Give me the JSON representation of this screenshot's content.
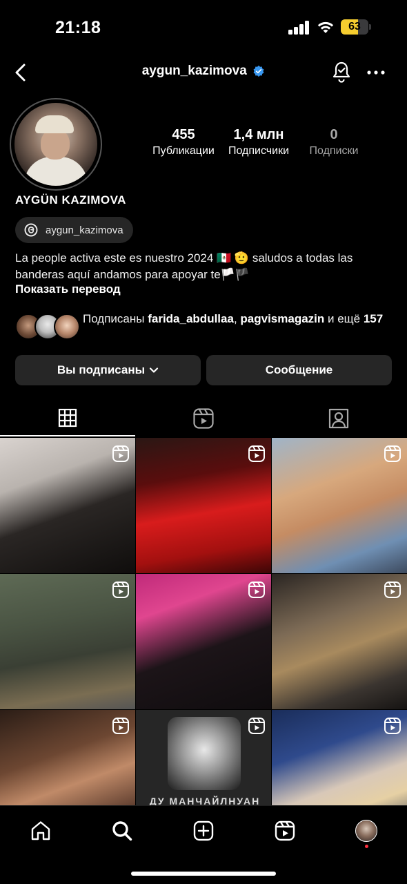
{
  "status_bar": {
    "time": "21:18",
    "battery_percent": "63",
    "battery_level": 0.63,
    "accent_color": "#f5cd2f"
  },
  "header": {
    "username": "aygun_kazimova",
    "verified": true,
    "icons": [
      "back-arrow-icon",
      "verified-badge-icon",
      "notification-bell-icon",
      "more-options-icon"
    ]
  },
  "profile": {
    "display_name": "AYGÜN KAZIMOVA",
    "stats": [
      {
        "value": "455",
        "label": "Публикации"
      },
      {
        "value": "1,4 млн",
        "label": "Подписчики"
      },
      {
        "value": "0",
        "label": "Подписки"
      }
    ],
    "threads_handle": "aygun_kazimova",
    "bio_line1": "La people activa este es nuestro 2024 🇲🇽 🫡 saludos a todas las",
    "bio_line2": "banderas aquí andamos para apoyar te🏳️🏴",
    "translate_label": "Показать перевод",
    "followed_by": {
      "prefix": "Подписаны ",
      "user1": "farida_abdullaa",
      "separator": ", ",
      "user2": "pagvismagazin",
      "and_more_prefix": " и ещё ",
      "more_count": "157"
    }
  },
  "actions": {
    "following_label": "Вы подписаны",
    "message_label": "Сообщение"
  },
  "tabs": [
    {
      "name": "grid",
      "icon": "grid-icon",
      "active": true
    },
    {
      "name": "reels",
      "icon": "reels-icon",
      "active": false
    },
    {
      "name": "tagged",
      "icon": "tagged-person-icon",
      "active": false
    }
  ],
  "grid": {
    "posts": [
      {
        "type": "reel"
      },
      {
        "type": "reel"
      },
      {
        "type": "reel"
      },
      {
        "type": "reel"
      },
      {
        "type": "reel"
      },
      {
        "type": "reel"
      },
      {
        "type": "reel"
      },
      {
        "type": "reel",
        "caption": "ДУ МАНЧАЙЛНУАН"
      },
      {
        "type": "reel"
      }
    ]
  },
  "bottom_nav": {
    "items": [
      "home-icon",
      "search-icon",
      "create-icon",
      "reels-icon",
      "profile-avatar"
    ],
    "active": "search",
    "notification_dot_color": "#ff3040"
  }
}
